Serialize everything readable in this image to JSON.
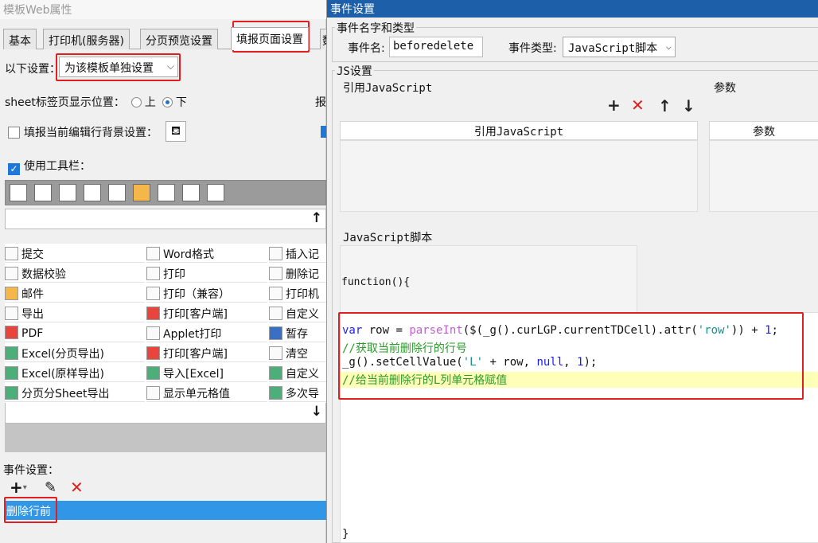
{
  "left_window": {
    "title": "模板Web属性",
    "tabs": [
      "基本",
      "打印机(服务器)",
      "分页预览设置",
      "填报页面设置",
      "数"
    ],
    "setting_label": "以下设置：",
    "setting_value": "为该模板单独设置",
    "sheet_pos_label": "sheet标签页显示位置：",
    "sheet_pos_options": [
      "上",
      "下"
    ],
    "sheet_pos_selected": "下",
    "cut_text_right": "报",
    "bg_setting_label": "填报当前编辑行背景设置：",
    "bg_setting_checked": false,
    "use_toolbar_label": "使用工具栏：",
    "use_toolbar_checked": true,
    "buttons_col1": [
      "提交",
      "数据校验",
      "邮件",
      "导出",
      "PDF",
      "Excel(分页导出)",
      "Excel(原样导出)",
      "分页分Sheet导出"
    ],
    "buttons_col2": [
      "Word格式",
      "打印",
      "打印（兼容）",
      "打印[客户端]",
      "Applet打印",
      "打印[客户端]",
      "导入[Excel]",
      "显示单元格值"
    ],
    "buttons_col3": [
      "插入记",
      "删除记",
      "打印机",
      "自定义",
      "暂存",
      "清空",
      "自定义",
      "多次导"
    ],
    "event_label": "事件设置：",
    "event_item": "删除行前",
    "arrow_up": "↑",
    "arrow_down": "↓"
  },
  "dialog": {
    "title": "事件设置",
    "name_type_group": "事件名字和类型",
    "event_name_label": "事件名:",
    "event_name_value": "beforedelete",
    "event_type_label": "事件类型:",
    "event_type_value": "JavaScript脚本",
    "js_group": "JS设置",
    "ref_js_label": "引用JavaScript",
    "params_label": "参数",
    "ref_js_header": "引用JavaScript",
    "params_header": "参数",
    "script_label": "JavaScript脚本",
    "func_header": "function(){",
    "close_brace": "}",
    "code_lines": [
      "var row = parseInt($(_g().curLGP.currentTDCell).attr('row')) + 1;",
      "//获取当前删除行的行号",
      "_g().setCellValue('L' + row, null, 1);",
      "//给当前删除行的L列单元格赋值"
    ]
  },
  "colors": {
    "highlight_red": "#e02020",
    "selection_blue": "#3296e6",
    "title_blue": "#1e5fa9"
  }
}
